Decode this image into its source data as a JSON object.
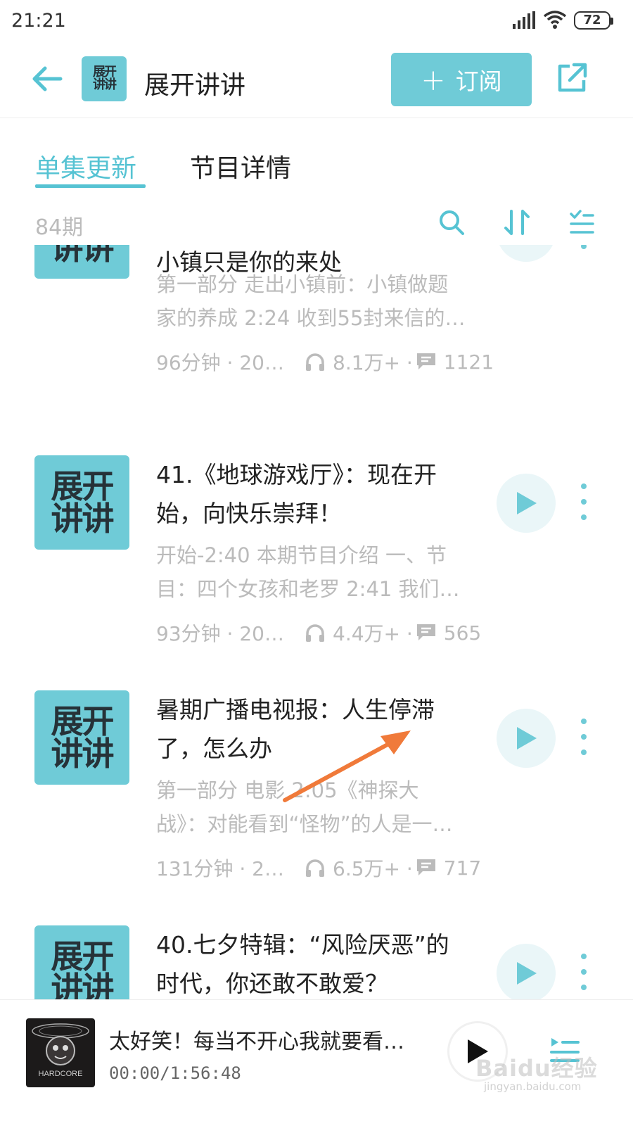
{
  "status_bar": {
    "time": "21:21",
    "battery": "72"
  },
  "header": {
    "title": "展开讲讲",
    "subscribe_label": "订阅",
    "logo_line1": "展开",
    "logo_line2": "讲讲"
  },
  "tabs": [
    {
      "label": "单集更新",
      "active": true
    },
    {
      "label": "节目详情",
      "active": false
    }
  ],
  "toolbar": {
    "episode_count": "84期"
  },
  "colors": {
    "accent": "#6fcbd7",
    "tab_active": "#56c3d3",
    "arrow": "#f07a3a"
  },
  "episodes": [
    {
      "title_lines": [
        "小镇只是你的来处"
      ],
      "desc_lines": [
        "第一部分 走出小镇前：小镇做题",
        "家的养成 2:24 收到55封来信的…"
      ],
      "duration": "96分钟 · 202…",
      "plays": "8.1万+ ·",
      "comments": "1121"
    },
    {
      "title_lines": [
        "41.《地球游戏厅》：现在开",
        "始，向快乐崇拜！"
      ],
      "desc_lines": [
        "开始-2:40 本期节目介绍 一、节",
        "目：四个女孩和老罗 2:41 我们…"
      ],
      "duration": "93分钟 · 2022…",
      "plays": "4.4万+ ·",
      "comments": "565"
    },
    {
      "title_lines": [
        "暑期广播电视报：人生停滞",
        "了，怎么办"
      ],
      "desc_lines": [
        "第一部分 电影 2:05《神探大",
        "战》：对能看到“怪物”的人是一…"
      ],
      "duration": "131分钟 · 202…",
      "plays": "6.5万+ ·",
      "comments": "717"
    },
    {
      "title_lines": [
        "40.七夕特辑：“风险厌恶”的",
        "时代，你还敢不敢爱？"
      ],
      "desc_lines": [
        "",
        ""
      ],
      "duration": "",
      "plays": "",
      "comments": ""
    }
  ],
  "player": {
    "title": "太好笑！每当不开心我就要看…",
    "time": "00:00/1:56:48",
    "cover_text": "HARDCORE"
  },
  "watermark": {
    "text": "Baidu经验",
    "sub": "jingyan.baidu.com"
  }
}
